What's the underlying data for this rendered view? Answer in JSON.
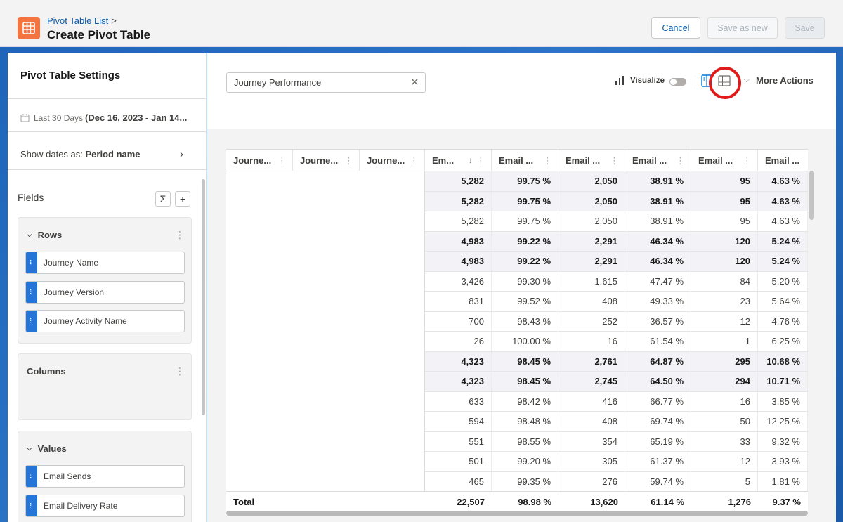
{
  "header": {
    "breadcrumb": "Pivot Table List",
    "breadcrumb_sep": ">",
    "title": "Create Pivot Table",
    "cancel_label": "Cancel",
    "save_as_new_label": "Save as new",
    "save_label": "Save"
  },
  "sidebar": {
    "title": "Pivot Table Settings",
    "date_range_label": "Last 30 Days",
    "date_range_value": "(Dec 16, 2023 - Jan 14...",
    "show_dates_label": "Show dates as:",
    "show_dates_value": "Period name",
    "fields_label": "Fields",
    "sigma_glyph": "Σ",
    "plus_glyph": "+",
    "rows_box": {
      "title": "Rows",
      "items": [
        "Journey Name",
        "Journey Version",
        "Journey Activity Name"
      ]
    },
    "columns_box": {
      "title": "Columns"
    },
    "values_box": {
      "title": "Values",
      "items": [
        "Email Sends",
        "Email Delivery Rate"
      ]
    }
  },
  "toolbar": {
    "report_title": "Journey Performance",
    "visualize_label": "Visualize",
    "more_actions_label": "More Actions"
  },
  "table": {
    "headers": [
      "Journe...",
      "Journe...",
      "Journe...",
      "Em...",
      "Email ...",
      "Email ...",
      "Email ...",
      "Email ...",
      "Email ..."
    ],
    "rows": [
      {
        "subtotal": true,
        "cells": [
          "5,282",
          "99.75 %",
          "2,050",
          "38.91 %",
          "95",
          "4.63 %"
        ]
      },
      {
        "subtotal": true,
        "cells": [
          "5,282",
          "99.75 %",
          "2,050",
          "38.91 %",
          "95",
          "4.63 %"
        ]
      },
      {
        "subtotal": false,
        "cells": [
          "5,282",
          "99.75 %",
          "2,050",
          "38.91 %",
          "95",
          "4.63 %"
        ]
      },
      {
        "subtotal": true,
        "cells": [
          "4,983",
          "99.22 %",
          "2,291",
          "46.34 %",
          "120",
          "5.24 %"
        ]
      },
      {
        "subtotal": true,
        "cells": [
          "4,983",
          "99.22 %",
          "2,291",
          "46.34 %",
          "120",
          "5.24 %"
        ]
      },
      {
        "subtotal": false,
        "cells": [
          "3,426",
          "99.30 %",
          "1,615",
          "47.47 %",
          "84",
          "5.20 %"
        ]
      },
      {
        "subtotal": false,
        "cells": [
          "831",
          "99.52 %",
          "408",
          "49.33 %",
          "23",
          "5.64 %"
        ]
      },
      {
        "subtotal": false,
        "cells": [
          "700",
          "98.43 %",
          "252",
          "36.57 %",
          "12",
          "4.76 %"
        ]
      },
      {
        "subtotal": false,
        "cells": [
          "26",
          "100.00 %",
          "16",
          "61.54 %",
          "1",
          "6.25 %"
        ]
      },
      {
        "subtotal": true,
        "cells": [
          "4,323",
          "98.45 %",
          "2,761",
          "64.87 %",
          "295",
          "10.68 %"
        ]
      },
      {
        "subtotal": true,
        "cells": [
          "4,323",
          "98.45 %",
          "2,745",
          "64.50 %",
          "294",
          "10.71 %"
        ]
      },
      {
        "subtotal": false,
        "cells": [
          "633",
          "98.42 %",
          "416",
          "66.77 %",
          "16",
          "3.85 %"
        ]
      },
      {
        "subtotal": false,
        "cells": [
          "594",
          "98.48 %",
          "408",
          "69.74 %",
          "50",
          "12.25 %"
        ]
      },
      {
        "subtotal": false,
        "cells": [
          "551",
          "98.55 %",
          "354",
          "65.19 %",
          "33",
          "9.32 %"
        ]
      },
      {
        "subtotal": false,
        "cells": [
          "501",
          "99.20 %",
          "305",
          "61.37 %",
          "12",
          "3.93 %"
        ]
      },
      {
        "subtotal": false,
        "cells": [
          "465",
          "99.35 %",
          "276",
          "59.74 %",
          "5",
          "1.81 %"
        ]
      }
    ],
    "total_label": "Total",
    "total_cells": [
      "22,507",
      "98.98 %",
      "13,620",
      "61.14 %",
      "1,276",
      "9.37 %"
    ]
  },
  "colors": {
    "accent": "#0b5cab",
    "app_icon": "#f5733f",
    "pill_handle": "#2574d8",
    "highlight_ring": "#e01b1b"
  }
}
